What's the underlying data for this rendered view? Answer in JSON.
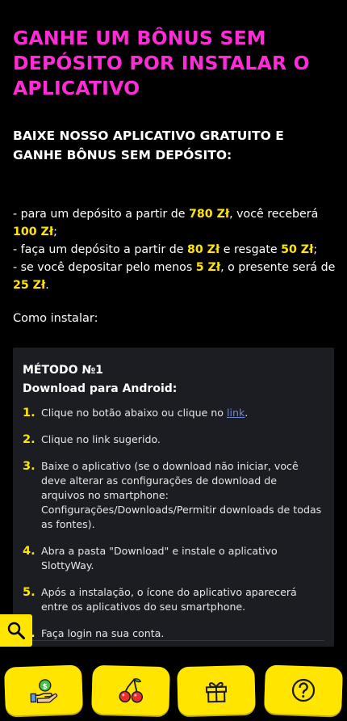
{
  "hero": {
    "title": "GANHE UM BÔNUS SEM DEPÓSITO POR INSTALAR O APLICATIVO"
  },
  "subtitle": "BAIXE NOSSO APLICATIVO GRATUITO E GANHE BÔNUS SEM DEPÓSITO:",
  "bonus": {
    "line1_a": "- para um depósito a partir de ",
    "line1_amount1": "780 Zł",
    "line1_b": ", você receberá ",
    "line1_amount2": "100 Zł",
    "line1_c": ";",
    "line2_a": "- faça um depósito a partir de ",
    "line2_amount1": "80 Zł",
    "line2_b": " e resgate ",
    "line2_amount2": "50 Zł",
    "line2_c": ";",
    "line3_a": "- se você depositar pelo menos ",
    "line3_amount1": "5 Zł",
    "line3_b": ", o presente será de ",
    "line3_amount2": "25 Zł",
    "line3_c": "."
  },
  "how_to_install": "Como instalar:",
  "method": {
    "title": "MÉTODO №1",
    "subtitle": "Download para Android:",
    "steps": [
      {
        "num": "1.",
        "text": "Clique no botão abaixo ou clique no ",
        "link": "link",
        "after": "."
      },
      {
        "num": "2.",
        "text": "Clique no link sugerido."
      },
      {
        "num": "3.",
        "text": "Baixe o aplicativo (se o download não iniciar, você deve alterar as configurações de download de arquivos no smartphone: Configurações/Downloads/Permitir downloads de todas as fontes)."
      },
      {
        "num": "4.",
        "text": "Abra a pasta \"Download\" e instale o aplicativo SlottyWay."
      },
      {
        "num": "5.",
        "text": "Após a instalação, o ícone do aplicativo aparecerá entre os aplicativos do seu smartphone."
      },
      {
        "num": "6.",
        "text": "Faça login na sua conta."
      }
    ]
  },
  "icons": {
    "search": "search-icon",
    "deposit": "money-hand-icon",
    "slots": "cherry-icon",
    "gifts": "gift-icon",
    "help": "question-icon"
  },
  "colors": {
    "accent_pink": "#ff2bd6",
    "accent_yellow": "#ffe500",
    "card_bg": "#1b1d22",
    "link": "#6f87c8"
  }
}
